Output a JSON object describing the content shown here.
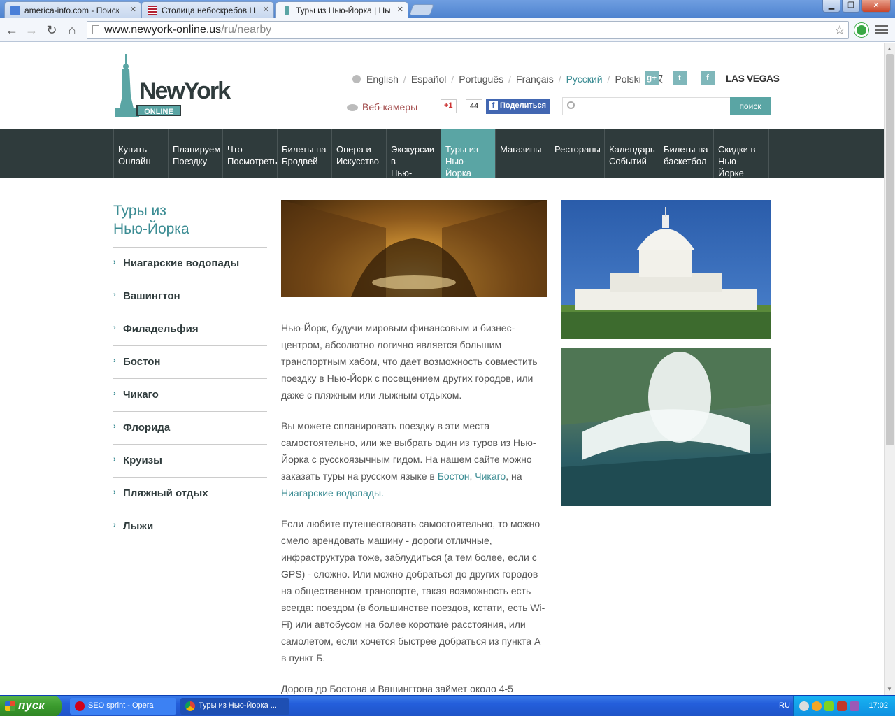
{
  "browser": {
    "tabs": [
      {
        "title": "america-info.com - Поиск в G",
        "favicon_color": "#4a7fd8"
      },
      {
        "title": "Столица небоскребов Нью-",
        "favicon_color": "#b22234"
      },
      {
        "title": "Туры из Нью-Йорка | Нью-Й",
        "favicon_color": "#5aa5a4"
      }
    ],
    "url_domain": "www.newyork-online.us",
    "url_path": "/ru/nearby"
  },
  "header": {
    "logo_text": "NewYork",
    "logo_badge": "ONLINE",
    "languages": [
      "English",
      "Español",
      "Português",
      "Français",
      "Русский",
      "Polski",
      "汉"
    ],
    "current_language": "Русский",
    "social": {
      "gplus": "g+",
      "twitter": "t",
      "facebook": "f"
    },
    "las_vegas": "LAS VEGAS",
    "webcams": "Веб-камеры",
    "gplus_button": "+1",
    "gplus_count": "44",
    "fb_share": "Поделиться",
    "search_placeholder": "",
    "search_button": "поиск"
  },
  "nav": [
    {
      "line1": "Купить",
      "line2": "Онлайн"
    },
    {
      "line1": "Планируем",
      "line2": "Поездку"
    },
    {
      "line1": "Что",
      "line2": "Посмотреть"
    },
    {
      "line1": "Билеты на",
      "line2": "Бродвей"
    },
    {
      "line1": "Опера и",
      "line2": "Искусство"
    },
    {
      "line1": "Экскурсии в",
      "line2": "Нью-Йорке"
    },
    {
      "line1": "Туры из",
      "line2": "Нью-Йорка"
    },
    {
      "line1": "Магазины",
      "line2": ""
    },
    {
      "line1": "Рестораны",
      "line2": ""
    },
    {
      "line1": "Календарь",
      "line2": "Событий"
    },
    {
      "line1": "Билеты на",
      "line2": "баскетбол"
    },
    {
      "line1": "Скидки в",
      "line2": "Нью-Йорке"
    }
  ],
  "sidebar": {
    "title_line1": "Туры из",
    "title_line2": "Нью-Йорка",
    "items": [
      "Ниагарские водопады",
      "Вашингтон",
      "Филадельфия",
      "Бостон",
      "Чикаго",
      "Флорида",
      "Круизы",
      "Пляжный отдых",
      "Лыжи"
    ]
  },
  "article": {
    "p1": "Нью-Йорк, будучи мировым финансовым и бизнес-центром, абсолютно логично является большим транспортным хабом, что дает возможность совместить поездку в Нью-Йорк с посещением других городов, или даже с пляжным или лыжным отдыхом.",
    "p2_start": "Вы можете спланировать поездку в эти места самостоятельно, или же выбрать один из туров из Нью-Йорка с русскоязычным гидом. На нашем сайте можно заказать туры на русском языке в ",
    "p2_link1": "Бостон",
    "p2_sep1": ", ",
    "p2_link2": "Чикаго",
    "p2_sep2": ", на ",
    "p2_link3": "Ниагарские водопады.",
    "p3": "Если любите путешествовать самостоятельно, то можно смело арендовать машину - дороги отличные, инфраструктура тоже, заблудиться (а тем более, если с GPS) - сложно. Или можно добраться до других городов на общественном транспорте, такая возможность есть всегда: поездом (в большинстве поездов, кстати, есть Wi-Fi) или автобусом на более короткие расстояния, или самолетом, если хочется быстрее добраться из пункта А в пункт Б.",
    "p4": "Дорога до Бостона и Вашингтона займет около 4-5"
  },
  "taskbar": {
    "start": "пуск",
    "buttons": [
      "SEO sprint - Opera",
      "Туры из Нью-Йорка ..."
    ],
    "language": "RU",
    "clock": "17:02"
  }
}
